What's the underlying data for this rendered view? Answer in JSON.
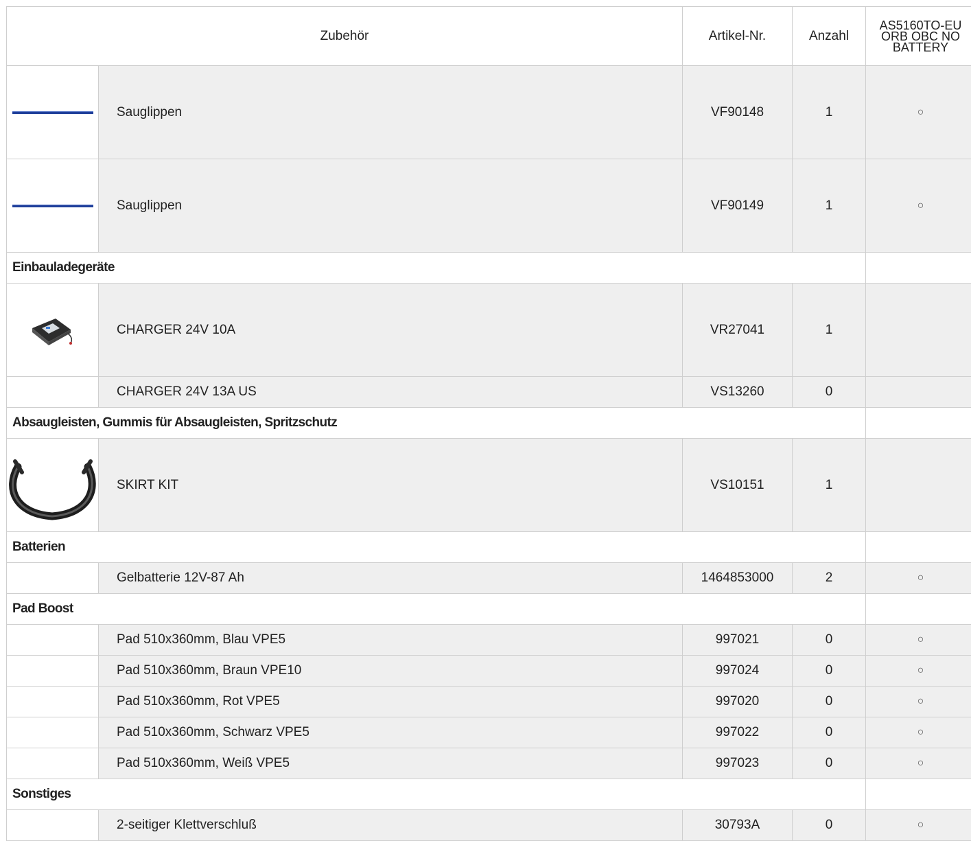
{
  "header": {
    "accessory_label": "Zubehör",
    "article_label": "Artikel-Nr.",
    "quantity_label": "Anzahl",
    "variant_label": "AS5160TO-EU ORB OBC NO BATTERY"
  },
  "rows": {
    "r0": {
      "name": "Sauglippen",
      "article": "VF90148",
      "qty": "1",
      "mark": "○",
      "image": "blue-squeegee-strip"
    },
    "r1": {
      "name": "Sauglippen",
      "article": "VF90149",
      "qty": "1",
      "mark": "○",
      "image": "blue-squeegee-strip"
    },
    "g0": {
      "title": "Einbauladegeräte"
    },
    "r2": {
      "name": "CHARGER 24V 10A",
      "article": "VR27041",
      "qty": "1",
      "mark": "",
      "image": "charger-unit"
    },
    "r3": {
      "name": "CHARGER 24V 13A US",
      "article": "VS13260",
      "qty": "0",
      "mark": ""
    },
    "g1": {
      "title": "Absaugleisten, Gummis für Absaugleisten, Spritzschutz"
    },
    "r4": {
      "name": "SKIRT KIT",
      "article": "VS10151",
      "qty": "1",
      "mark": "",
      "image": "skirt-kit-ring"
    },
    "g2": {
      "title": "Batterien"
    },
    "r5": {
      "name": "Gelbatterie 12V-87 Ah",
      "article": "1464853000",
      "qty": "2",
      "mark": "○"
    },
    "g3": {
      "title": "Pad Boost"
    },
    "r6": {
      "name": "Pad 510x360mm, Blau VPE5",
      "article": "997021",
      "qty": "0",
      "mark": "○"
    },
    "r7": {
      "name": "Pad 510x360mm, Braun VPE10",
      "article": "997024",
      "qty": "0",
      "mark": "○"
    },
    "r8": {
      "name": "Pad 510x360mm, Rot VPE5",
      "article": "997020",
      "qty": "0",
      "mark": "○"
    },
    "r9": {
      "name": "Pad 510x360mm, Schwarz VPE5",
      "article": "997022",
      "qty": "0",
      "mark": "○"
    },
    "r10": {
      "name": "Pad 510x360mm, Weiß VPE5",
      "article": "997023",
      "qty": "0",
      "mark": "○"
    },
    "g4": {
      "title": "Sonstiges"
    },
    "r11": {
      "name": "2-seitiger Klettverschluß",
      "article": "30793A",
      "qty": "0",
      "mark": "○"
    }
  },
  "colors": {
    "item_bg": "#efefef",
    "border": "#cfcfcf",
    "squeegee_blue": "#1f3f9a"
  }
}
